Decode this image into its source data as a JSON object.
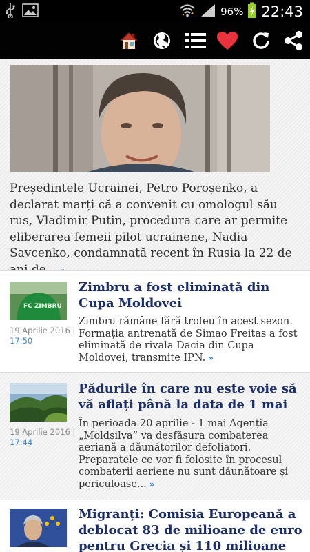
{
  "status_bar": {
    "time": "22:43",
    "battery": "96%",
    "icons": [
      "usb-icon",
      "image-icon",
      "wifi-icon",
      "signal-icon",
      "battery-icon"
    ]
  },
  "toolbar": {
    "icons": [
      "home-icon",
      "globe-icon",
      "list-icon",
      "heart-icon",
      "refresh-icon",
      "share-icon"
    ]
  },
  "featured": {
    "text": "Președintele Ucrainei, Petro Poroșenko, a declarat marți că a convenit cu omologul său rus, Vladimir Putin, procedura care ar permite eliberarea femeii pilot ucrainene, Nadia Savcenko, condamnată recent în Rusia la 22 de ani de...",
    "more": "»"
  },
  "articles": [
    {
      "title": "Zimbru a fost eliminată din Cupa Moldovei",
      "date": "19 Aprilie 2016 |",
      "time": "17:50",
      "excerpt": "Zimbru rămâne fără trofeu în acest sezon. Formația antrenată de Simao Freitas a fost eliminată de rivala Dacia din Cupa Moldovei, transmite IPN.",
      "more": "»"
    },
    {
      "title": "Pădurile în care nu este voie să vă aflați până la data de 1 mai",
      "date": "19 Aprilie 2016 |",
      "time": "17:44",
      "excerpt": "În perioada 20 aprilie - 1 mai Agenția „Moldsilva” va desfășura combaterea aeriană a dăunătorilor defoliatori. Preparatele ce vor fi folosite în procesul combaterii aeriene nu sunt dăunătoare și periculoase...",
      "more": "»"
    },
    {
      "title": "Migranți: Comisia Europeană a deblocat 83 de milioane de euro pentru Grecia și 110 milioane"
    }
  ],
  "colors": {
    "toolbar_bg": "#020202",
    "title": "#1d2f69",
    "link": "#3a86c9",
    "heart": "#e8323c"
  }
}
